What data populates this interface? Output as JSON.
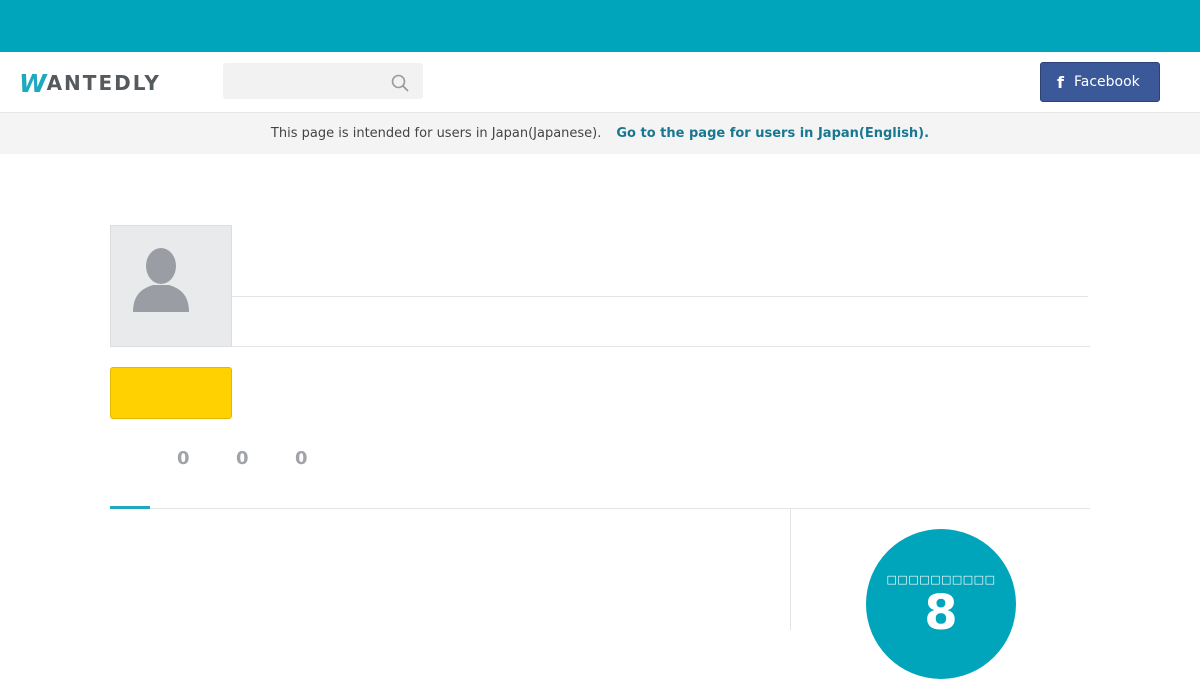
{
  "header": {
    "logo_initial": "W",
    "logo_rest": "ANTEDLY",
    "search": {
      "placeholder": "",
      "value": ""
    },
    "facebook_button": {
      "icon": "f",
      "label": "Facebook"
    }
  },
  "notice": {
    "text": "This page is intended for users in Japan(Japanese).",
    "link": "Go to the page for users in Japan(English)."
  },
  "profile": {
    "counts": [
      "0",
      "0",
      "0"
    ]
  },
  "sidebar": {
    "score_label": "□□□□□□□□□□",
    "score_value": "8"
  },
  "colors": {
    "brand": "#00a4bb",
    "facebook": "#3b5998",
    "cta_yellow": "#ffd100"
  }
}
